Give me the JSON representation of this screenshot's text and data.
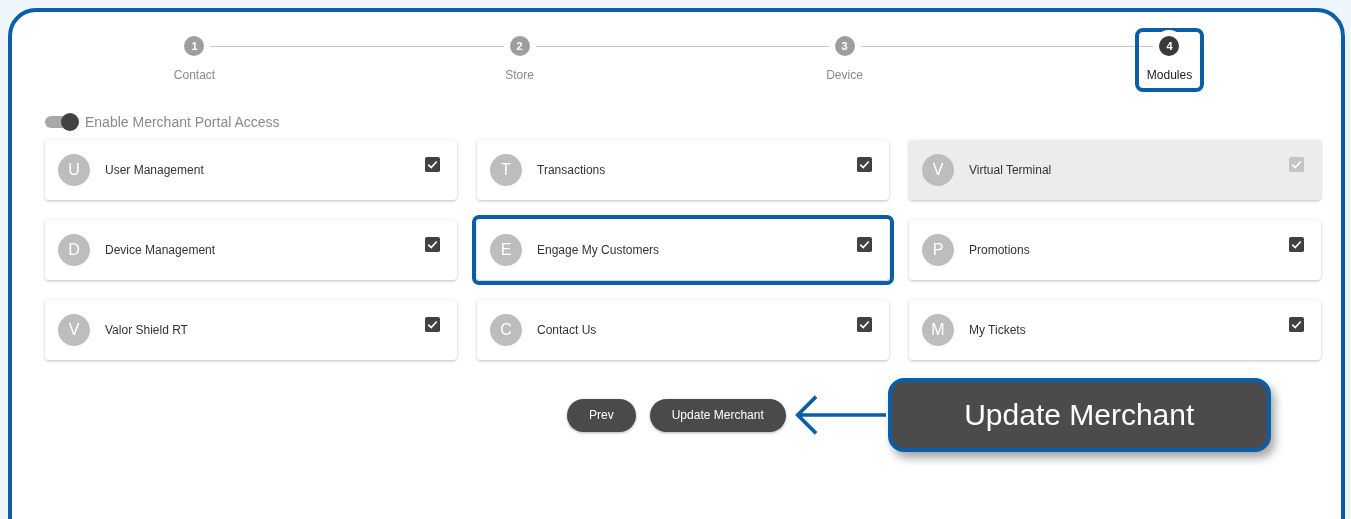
{
  "steps": [
    {
      "number": "1",
      "label": "Contact",
      "selected": false,
      "highlighted": false
    },
    {
      "number": "2",
      "label": "Store",
      "selected": false,
      "highlighted": false
    },
    {
      "number": "3",
      "label": "Device",
      "selected": false,
      "highlighted": false
    },
    {
      "number": "4",
      "label": "Modules",
      "selected": true,
      "highlighted": true
    }
  ],
  "portal_access": {
    "label": "Enable Merchant Portal Access",
    "on": true
  },
  "modules": [
    {
      "letter": "U",
      "name": "User Management",
      "checked": true,
      "disabled": false,
      "highlighted": false
    },
    {
      "letter": "T",
      "name": "Transactions",
      "checked": true,
      "disabled": false,
      "highlighted": false
    },
    {
      "letter": "V",
      "name": "Virtual Terminal",
      "checked": true,
      "disabled": true,
      "highlighted": false
    },
    {
      "letter": "D",
      "name": "Device Management",
      "checked": true,
      "disabled": false,
      "highlighted": false
    },
    {
      "letter": "E",
      "name": "Engage My Customers",
      "checked": true,
      "disabled": false,
      "highlighted": true
    },
    {
      "letter": "P",
      "name": "Promotions",
      "checked": true,
      "disabled": false,
      "highlighted": false
    },
    {
      "letter": "V",
      "name": "Valor Shield RT",
      "checked": true,
      "disabled": false,
      "highlighted": false
    },
    {
      "letter": "C",
      "name": "Contact Us",
      "checked": true,
      "disabled": false,
      "highlighted": false
    },
    {
      "letter": "M",
      "name": "My Tickets",
      "checked": true,
      "disabled": false,
      "highlighted": false
    }
  ],
  "buttons": [
    "Prev",
    "Update Merchant"
  ],
  "callout": {
    "text": "Update Merchant"
  }
}
